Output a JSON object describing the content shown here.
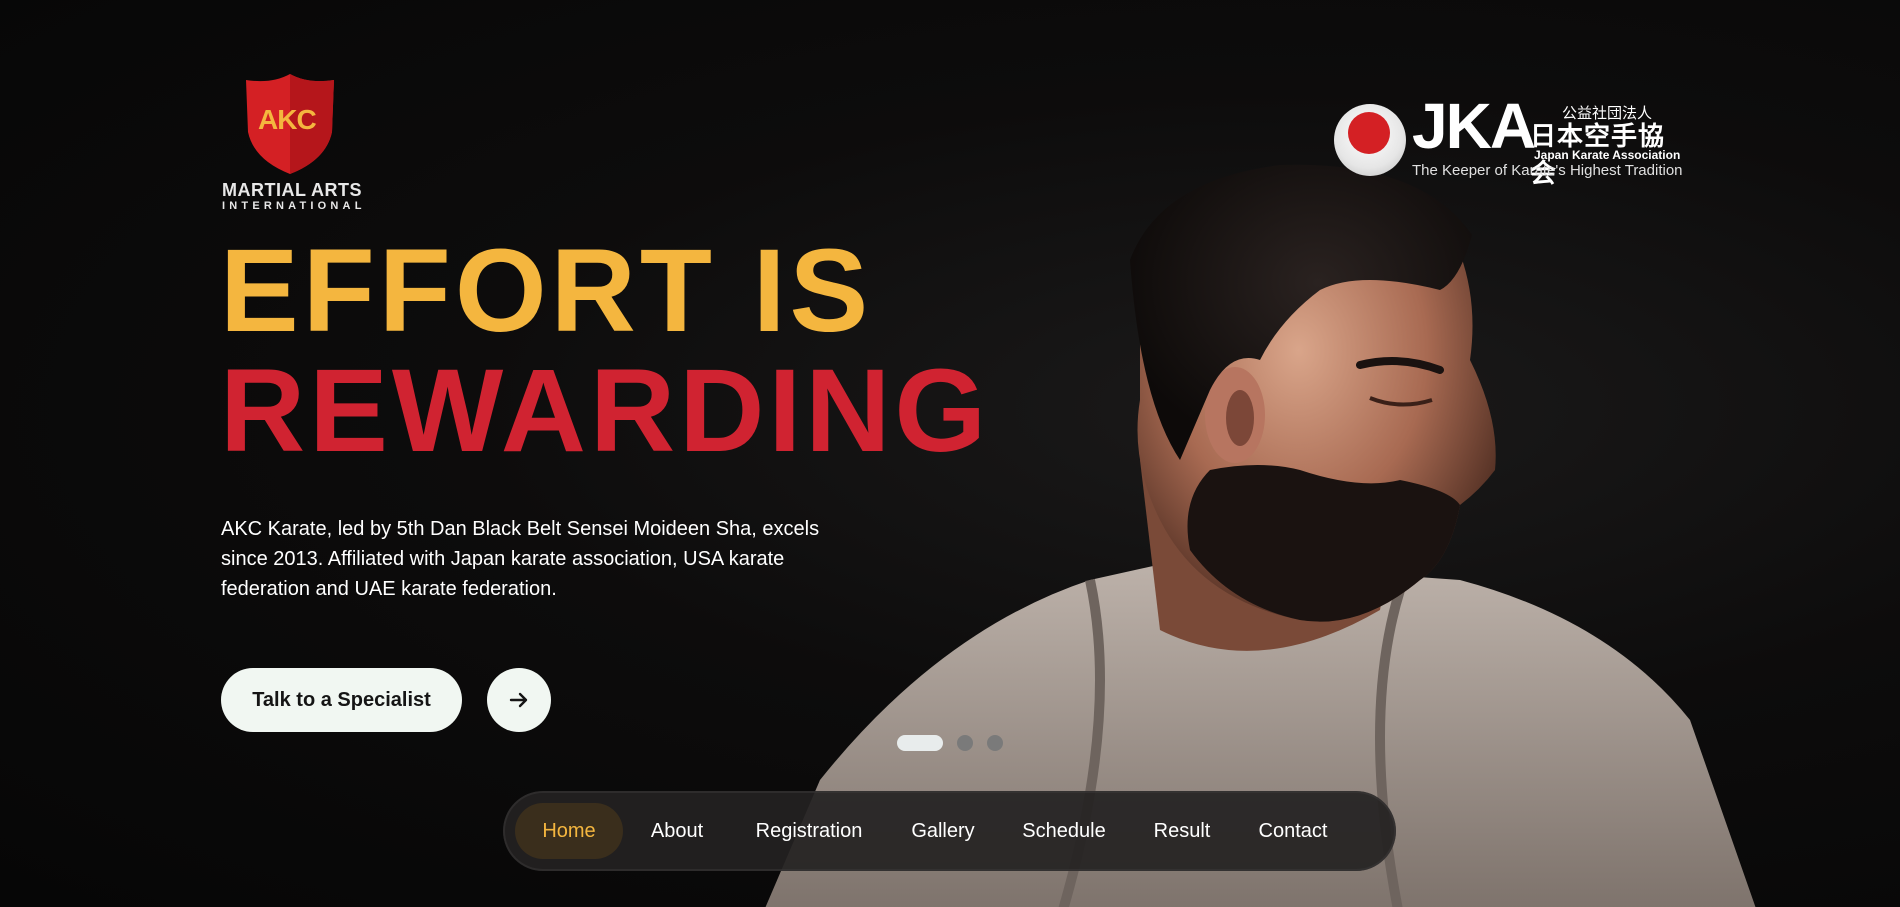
{
  "brand": {
    "logo_initials": "AKC",
    "logo_line1": "MARTIAL ARTS",
    "logo_line2": "INTERNATIONAL",
    "shield_color": "#d42024",
    "initials_color": "#f4b63f"
  },
  "affiliate": {
    "name": "JKA",
    "kanji_top": "公益社団法人",
    "kanji": "日本空手協会",
    "subtitle": "Japan Karate Association",
    "tagline": "The Keeper of Karate's Highest Tradition"
  },
  "hero": {
    "headline_line1": "EFFORT IS",
    "headline_line2": "REWARDING",
    "headline_color1": "#f4b63f",
    "headline_color2": "#d02331",
    "description": "AKC Karate, led by 5th Dan Black Belt Sensei Moideen Sha, excels since 2013. Affiliated with Japan karate association, USA karate federation and UAE karate federation.",
    "cta_label": "Talk to a Specialist",
    "arrow_icon": "arrow-right-icon"
  },
  "carousel": {
    "slides": 3,
    "active_slide": 1
  },
  "nav": {
    "items": [
      {
        "label": "Home",
        "active": true
      },
      {
        "label": "About",
        "active": false
      },
      {
        "label": "Registration",
        "active": false
      },
      {
        "label": "Gallery",
        "active": false
      },
      {
        "label": "Schedule",
        "active": false
      },
      {
        "label": "Result",
        "active": false
      },
      {
        "label": "Contact",
        "active": false
      }
    ]
  }
}
